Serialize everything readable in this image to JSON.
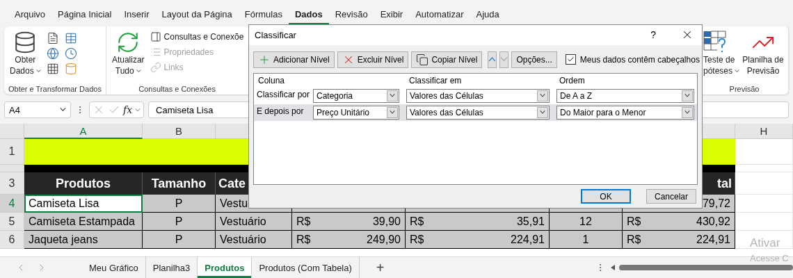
{
  "menu_tabs": [
    {
      "label": "Arquivo",
      "selected": false
    },
    {
      "label": "Página Inicial",
      "selected": false
    },
    {
      "label": "Inserir",
      "selected": false
    },
    {
      "label": "Layout da Página",
      "selected": false
    },
    {
      "label": "Fórmulas",
      "selected": false
    },
    {
      "label": "Dados",
      "selected": true
    },
    {
      "label": "Revisão",
      "selected": false
    },
    {
      "label": "Exibir",
      "selected": false
    },
    {
      "label": "Automatizar",
      "selected": false
    },
    {
      "label": "Ajuda",
      "selected": false
    }
  ],
  "ribbon": {
    "get_data": {
      "lines": [
        "Obter",
        "Dados"
      ],
      "group_label": "Obter e Transformar Dados"
    },
    "queries": {
      "lines": [
        "Atualizar",
        "Tudo"
      ],
      "items": [
        {
          "label": "Consultas e Conexõe",
          "disabled": false
        },
        {
          "label": "Propriedades",
          "disabled": true
        },
        {
          "label": "Links",
          "disabled": true
        }
      ],
      "group_label": "Consultas e Conexões"
    },
    "forecast": {
      "buttons": [
        {
          "kind": "what_if",
          "lines": [
            "Teste de",
            "póteses"
          ]
        },
        {
          "kind": "forecast",
          "lines": [
            "Planilha de",
            "Previsão"
          ]
        }
      ],
      "group_label": "Previsão"
    }
  },
  "formula_bar": {
    "name_box": "A4",
    "function_label": "fx",
    "value": "Camiseta Lisa"
  },
  "sheet": {
    "column_headers": {
      "a": {
        "letter": "A",
        "selected": true
      },
      "b": {
        "letter": "B",
        "selected": false
      },
      "h": {
        "letter": "H",
        "selected": false
      }
    },
    "rows": [
      {
        "number": "1",
        "kind": "banner"
      },
      {
        "kind": "divider"
      },
      {
        "number": "3",
        "kind": "header",
        "cells": {
          "a": "Produtos",
          "b": "Tamanho",
          "c": "Cate",
          "g": "tal"
        }
      },
      {
        "number": "4",
        "kind": "data",
        "selected": true,
        "cells": {
          "a": "Camiseta Lisa",
          "b": "P",
          "c": "Vestu",
          "g": {
            "value": "79,72"
          }
        }
      },
      {
        "number": "5",
        "kind": "data",
        "selected": false,
        "cells": {
          "a": "Camiseta Estampada",
          "b": "P",
          "c": "Vestuário",
          "d": {
            "currency": "R$",
            "value": "39,90"
          },
          "e": {
            "currency": "R$",
            "value": "35,91"
          },
          "f": "12",
          "g": {
            "currency": "R$",
            "value": "430,92"
          }
        }
      },
      {
        "number": "6",
        "kind": "data",
        "selected": false,
        "cells": {
          "a": "Jaqueta jeans",
          "b": "P",
          "c": "Vestuário",
          "d": {
            "currency": "R$",
            "value": "249,90"
          },
          "e": {
            "currency": "R$",
            "value": "224,91"
          },
          "f": "1",
          "g": {
            "currency": "R$",
            "value": "224,91"
          }
        }
      }
    ]
  },
  "sort_dialog": {
    "title": "Classificar",
    "help": "?",
    "toolbar": [
      {
        "kind": "add",
        "label": "Adicionar Nível",
        "disabled": false
      },
      {
        "kind": "delete",
        "label": "Excluir Nível",
        "disabled": false
      },
      {
        "kind": "copy",
        "label": "Copiar Nível",
        "disabled": false
      },
      {
        "kind": "up",
        "disabled": false
      },
      {
        "kind": "down",
        "disabled": true
      },
      {
        "kind": "options",
        "label": "Opções...",
        "disabled": false
      }
    ],
    "has_headers": {
      "label": "Meus dados contêm cabeçalhos",
      "checked": true
    },
    "columns": [
      "Coluna",
      "Classificar em",
      "Ordem"
    ],
    "levels": [
      {
        "label": "Classificar por",
        "column": "Categoria",
        "sort_on": "Valores das Células",
        "order": "De A a Z",
        "selected": false
      },
      {
        "label": "E depois por",
        "column": "Preço Unitário",
        "sort_on": "Valores das Células",
        "order": "Do Maior para o Menor",
        "selected": true
      }
    ],
    "buttons": [
      {
        "label": "OK",
        "default": true
      },
      {
        "label": "Cancelar",
        "default": false
      }
    ]
  },
  "sheet_tabs": [
    {
      "label": "Meu Gráfico",
      "selected": false
    },
    {
      "label": "Planilha3",
      "selected": false
    },
    {
      "label": "Produtos",
      "selected": true
    },
    {
      "label": "Produtos (Com Tabela)",
      "selected": false
    }
  ],
  "add_sheet": "+",
  "activation_notice": [
    "Ativar",
    "Acesse C"
  ]
}
